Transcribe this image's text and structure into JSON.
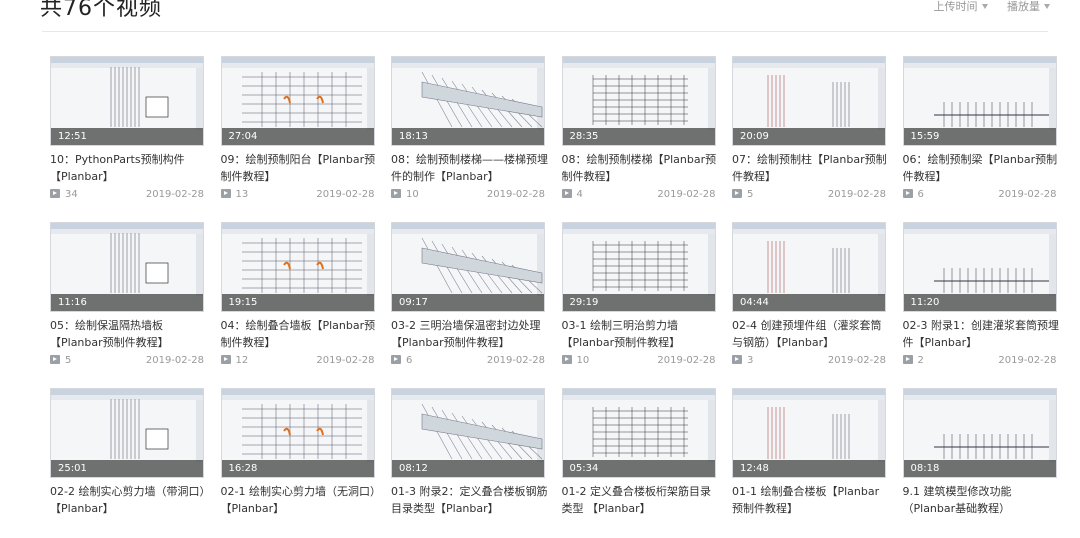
{
  "header": {
    "title": "共76个视频",
    "sort_upload": "上传时间",
    "sort_plays": "播放量"
  },
  "videos": [
    {
      "duration": "12:51",
      "title": "10：PythonParts预制构件【Planbar】",
      "count": "34",
      "date": "2019-02-28"
    },
    {
      "duration": "27:04",
      "title": "09：绘制预制阳台【Planbar预制件教程】",
      "count": "13",
      "date": "2019-02-28"
    },
    {
      "duration": "18:13",
      "title": "08：绘制预制楼梯——楼梯预埋件的制作【Planbar】",
      "count": "10",
      "date": "2019-02-28"
    },
    {
      "duration": "28:35",
      "title": "08：绘制预制楼梯【Planbar预制件教程】",
      "count": "4",
      "date": "2019-02-28"
    },
    {
      "duration": "20:09",
      "title": "07：绘制预制柱【Planbar预制件教程】",
      "count": "5",
      "date": "2019-02-28"
    },
    {
      "duration": "15:59",
      "title": "06：绘制预制梁【Planbar预制件教程】",
      "count": "6",
      "date": "2019-02-28"
    },
    {
      "duration": "11:16",
      "title": "05：绘制保温隔热墙板【Planbar预制件教程】",
      "count": "5",
      "date": "2019-02-28"
    },
    {
      "duration": "19:15",
      "title": "04：绘制叠合墙板【Planbar预制件教程】",
      "count": "12",
      "date": "2019-02-28"
    },
    {
      "duration": "09:17",
      "title": "03-2 三明治墙保温密封边处理【Planbar预制件教程】",
      "count": "6",
      "date": "2019-02-28"
    },
    {
      "duration": "29:19",
      "title": "03-1 绘制三明治剪力墙【Planbar预制件教程】",
      "count": "10",
      "date": "2019-02-28"
    },
    {
      "duration": "04:44",
      "title": "02-4 创建预埋件组（灌浆套筒与钢筋）【Planbar】",
      "count": "3",
      "date": "2019-02-28"
    },
    {
      "duration": "11:20",
      "title": "02-3 附录1：创建灌浆套筒预埋件【Planbar】",
      "count": "2",
      "date": "2019-02-28"
    },
    {
      "duration": "25:01",
      "title": "02-2 绘制实心剪力墙（带洞口）【Planbar】",
      "count": "",
      "date": ""
    },
    {
      "duration": "16:28",
      "title": "02-1 绘制实心剪力墙（无洞口）【Planbar】",
      "count": "",
      "date": ""
    },
    {
      "duration": "08:12",
      "title": "01-3 附录2：定义叠合楼板钢筋目录类型【Planbar】",
      "count": "",
      "date": ""
    },
    {
      "duration": "05:34",
      "title": "01-2 定义叠合楼板桁架筋目录类型 【Planbar】",
      "count": "",
      "date": ""
    },
    {
      "duration": "12:48",
      "title": "01-1 绘制叠合楼板【Planbar预制件教程】",
      "count": "",
      "date": ""
    },
    {
      "duration": "08:18",
      "title": "9.1 建筑模型修改功能（Planbar基础教程）",
      "count": "",
      "date": ""
    }
  ]
}
